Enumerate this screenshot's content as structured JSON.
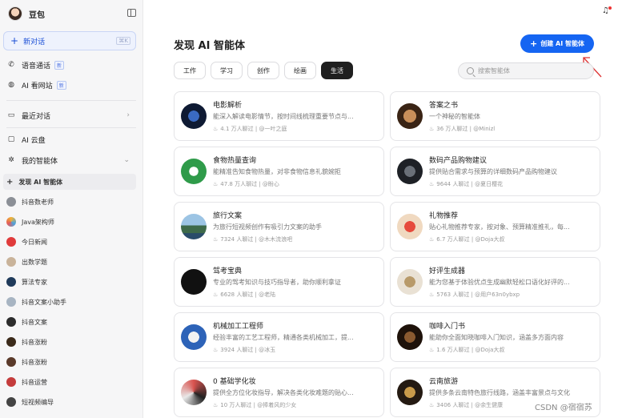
{
  "app": {
    "name": "豆包"
  },
  "sidebar": {
    "new_chat": {
      "label": "新对话",
      "shortcut": "⌘K"
    },
    "items": [
      {
        "label": "语音通话",
        "badge": "新",
        "icon": "phone-icon"
      },
      {
        "label": "AI 看网站",
        "badge": "新",
        "icon": "web-icon"
      }
    ],
    "recent": {
      "label": "最近对话"
    },
    "cloud": {
      "label": "AI 云盘"
    },
    "agents": {
      "label": "我的智能体"
    },
    "discover": {
      "label": "发现 AI 智能体"
    },
    "agent_list": [
      "抖音数老师",
      "Java架构师",
      "今日新闻",
      "出数学题",
      "算法专家",
      "抖音文案小助手",
      "抖音文案",
      "抖音涨粉",
      "抖音涨粉",
      "抖音运营",
      "短视频编导"
    ]
  },
  "main": {
    "title": "发现 AI 智能体",
    "create_label": "创建 AI 智能体",
    "search_placeholder": "搜索智能体",
    "tabs": [
      "工作",
      "学习",
      "创作",
      "绘画",
      "生活"
    ],
    "active_tab": "生活",
    "cards": [
      {
        "name": "电影解析",
        "desc": "能深入解读电影情节，按时间线梳理重要节点与...",
        "users": "4.1 万人聊过",
        "author": "@一叶之庭"
      },
      {
        "name": "答案之书",
        "desc": "一个神秘的智能体",
        "users": "36 万人聊过",
        "author": "@Minizl"
      },
      {
        "name": "食物热量查询",
        "desc": "能精准告知食物热量，对非食物信息礼貌婉拒",
        "users": "47.8 万人聊过",
        "author": "@盼心"
      },
      {
        "name": "数码产品购物建议",
        "desc": "提供贴合需求与预算的详细数码产品购物建议",
        "users": "9644 人聊过",
        "author": "@夏日樱花"
      },
      {
        "name": "旅行文案",
        "desc": "为旅行短视频创作有吸引力文案的助手",
        "users": "7324 人聊过",
        "author": "@木木流浪吧"
      },
      {
        "name": "礼物推荐",
        "desc": "贴心礼物推荐专家，按对象、预算精准推礼，每...",
        "users": "6.7 万人聊过",
        "author": "@Doja大叔"
      },
      {
        "name": "驾考宝典",
        "desc": "专业的驾考知识与技巧指导者，助你顺利拿证",
        "users": "6628 人聊过",
        "author": "@老陆"
      },
      {
        "name": "好评生成器",
        "desc": "能为您基于体验优点生成幽默轻松口语化好评的...",
        "users": "5763 人聊过",
        "author": "@用户63n0ybxp"
      },
      {
        "name": "机械加工工程师",
        "desc": "经验丰富的工艺工程师，精通各类机械加工，提...",
        "users": "3924 人聊过",
        "author": "@冰玉"
      },
      {
        "name": "咖啡入门书",
        "desc": "能助你全面知晓咖啡入门知识，涵盖多方面内容",
        "users": "1.6 万人聊过",
        "author": "@Doja大叔"
      },
      {
        "name": "0 基础学化妆",
        "desc": "提供全方位化妆指导，解决各类化妆难题的贴心...",
        "users": "10 万人聊过",
        "author": "@捧着风的少女"
      },
      {
        "name": "云南旅游",
        "desc": "提供多条云南特色旅行线路，涵盖丰富景点与文化",
        "users": "3406 人聊过",
        "author": "@余生健康"
      }
    ]
  },
  "watermark": "CSDN @宿宿苏"
}
